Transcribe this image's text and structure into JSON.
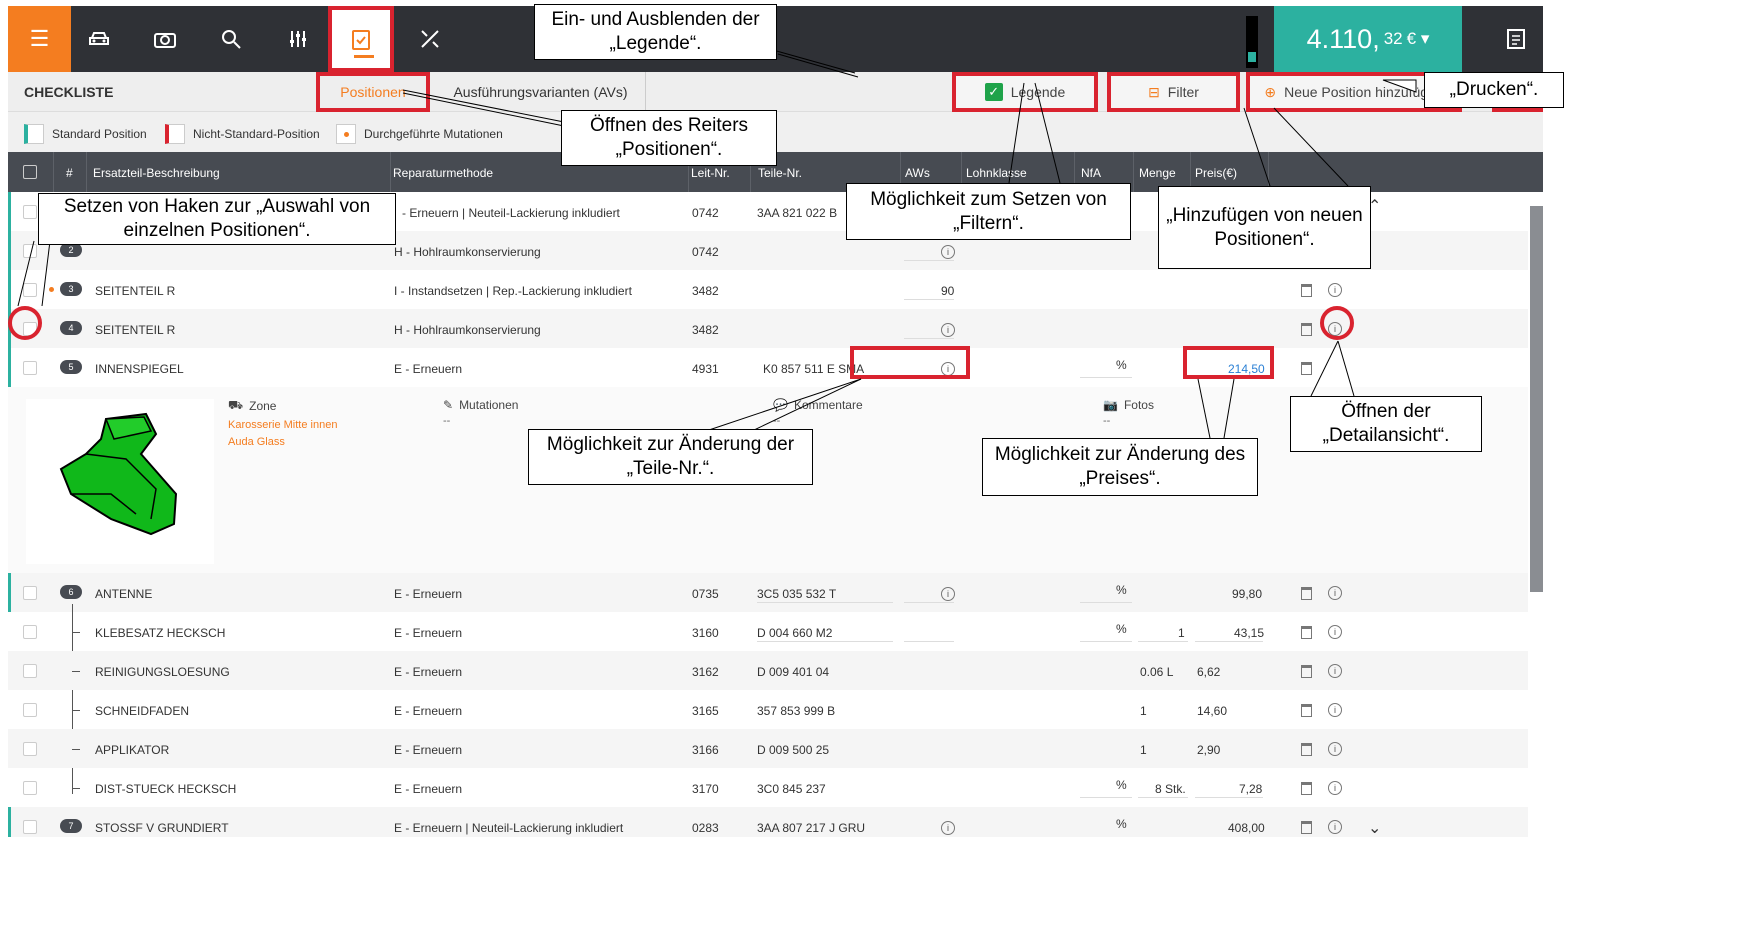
{
  "nav": {
    "icons": [
      "menu-icon",
      "car-icon",
      "camera-icon",
      "search-icon",
      "sliders-icon",
      "checklist-icon",
      "tools-icon"
    ],
    "price_main": "4.110,",
    "price_cents": "32",
    "price_currency": "€ ▾"
  },
  "toolbar": {
    "title": "CHECKLISTE",
    "tab_positions": "Positionen",
    "tab_avs": "Ausführungsvarianten (AVs)",
    "legend_label": "Legende",
    "filter_label": "Filter",
    "new_position_label": "Neue Position hinzufügen"
  },
  "legend": {
    "standard": "Standard Position",
    "nonstandard": "Nicht-Standard-Position",
    "mutations": "Durchgeführte Mutationen"
  },
  "columns": {
    "num": "#",
    "description": "Ersatzteil-Beschreibung",
    "method": "Reparaturmethode",
    "leit": "Leit-Nr.",
    "teile": "Teile-Nr.",
    "aws": "AWs",
    "lohn": "Lohnklasse",
    "nfa": "NfA",
    "menge": "Menge",
    "preis": "Preis(€)"
  },
  "rows": [
    {
      "num": "",
      "desc": "",
      "method": "- Erneuern | Neuteil-Lackierung inkludiert",
      "leit": "0742",
      "teile": "3AA 821 022 B",
      "aws": "",
      "pct": "",
      "menge": "",
      "preis": ""
    },
    {
      "num": "2",
      "desc": "",
      "method": "H - Hohlraumkonservierung",
      "leit": "0742",
      "teile": "",
      "aws": "",
      "pct": "",
      "menge": "",
      "preis": ""
    },
    {
      "num": "3",
      "desc": "SEITENTEIL R",
      "method": "I - Instandsetzen | Rep.-Lackierung inkludiert",
      "leit": "3482",
      "teile": "",
      "aws": "90",
      "pct": "",
      "menge": "",
      "preis": ""
    },
    {
      "num": "4",
      "desc": "SEITENTEIL R",
      "method": "H - Hohlraumkonservierung",
      "leit": "3482",
      "teile": "",
      "aws": "",
      "pct": "",
      "menge": "",
      "preis": ""
    },
    {
      "num": "5",
      "desc": "INNENSPIEGEL",
      "method": "E - Erneuern",
      "leit": "4931",
      "teile": "K0 857 511 E  SMA",
      "aws": "",
      "pct": "%",
      "menge": "",
      "preis": "214,50"
    },
    {
      "num": "6",
      "desc": "ANTENNE",
      "method": "E - Erneuern",
      "leit": "0735",
      "teile": "3C5 035 532 T",
      "aws": "",
      "pct": "%",
      "menge": "",
      "preis": "99,80"
    },
    {
      "num": "",
      "desc": "KLEBESATZ HECKSCH",
      "method": "E - Erneuern",
      "leit": "3160",
      "teile": "D   004 660 M2",
      "aws": "",
      "pct": "%",
      "menge": "1",
      "preis": "43,15"
    },
    {
      "num": "",
      "desc": "REINIGUNGSLOESUNG",
      "method": "E - Erneuern",
      "leit": "3162",
      "teile": "D 009 401 04",
      "aws": "",
      "pct": "",
      "menge": "0.06 L",
      "preis": "6,62"
    },
    {
      "num": "",
      "desc": "SCHNEIDFADEN",
      "method": "E - Erneuern",
      "leit": "3165",
      "teile": "357 853 999 B",
      "aws": "",
      "pct": "",
      "menge": "1",
      "preis": "14,60"
    },
    {
      "num": "",
      "desc": "APPLIKATOR",
      "method": "E - Erneuern",
      "leit": "3166",
      "teile": "D 009 500 25",
      "aws": "",
      "pct": "",
      "menge": "1",
      "preis": "2,90"
    },
    {
      "num": "",
      "desc": "DIST-STUECK HECKSCH",
      "method": "E - Erneuern",
      "leit": "3170",
      "teile": "3C0 845 237",
      "aws": "",
      "pct": "%",
      "menge": "8 Stk.",
      "preis": "7,28"
    },
    {
      "num": "7",
      "desc": "STOSSF V GRUNDIERT",
      "method": "E - Erneuern | Neuteil-Lackierung inkludiert",
      "leit": "0283",
      "teile": "3AA 807 217 J  GRU",
      "aws": "",
      "pct": "%",
      "menge": "",
      "preis": "408,00"
    }
  ],
  "detail": {
    "zone_label": "Zone",
    "zone_value1": "Karosserie Mitte innen",
    "zone_value2": "Auda Glass",
    "mutations_label": "Mutationen",
    "mutations_value": "--",
    "comments_label": "Kommentare",
    "comments_value": "--",
    "photos_label": "Fotos",
    "photos_value": "--"
  },
  "callouts": {
    "legend": "Ein- und Ausblenden der „Legende“.",
    "positions_tab": "Öffnen des Reiters „Positionen“.",
    "print": "„Drucken“.",
    "select": "Setzen von Haken zur „Auswahl von einzelnen Positionen“.",
    "filter": "Möglichkeit zum Setzen von „Filtern“.",
    "add": "„Hinzufügen von neuen Positionen“.",
    "detail": "Öffnen der „Detailansicht“.",
    "part_no": "Möglichkeit zur Änderung der „Teile-Nr.“.",
    "price": "Möglichkeit zur Änderung des „Preises“."
  },
  "colors": {
    "accent": "#f47d20",
    "teal": "#2cb1a0",
    "highlight": "#d9232f",
    "header": "#474b52"
  }
}
